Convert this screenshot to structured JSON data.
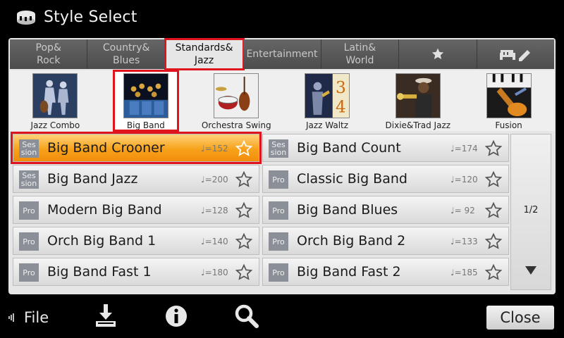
{
  "header": {
    "title": "Style Select",
    "icon": "keyboard-style-icon"
  },
  "tabs": [
    {
      "label": "Pop&\nRock",
      "active": false
    },
    {
      "label": "Country&\nBlues",
      "active": false
    },
    {
      "label": "Standards&\nJazz",
      "active": true
    },
    {
      "label": "Entertainment",
      "active": false
    },
    {
      "label": "Latin&\nWorld",
      "active": false
    },
    {
      "label": "",
      "icon": "star-icon",
      "active": false
    },
    {
      "label": "",
      "icon": "user-keyboard-edit-icon",
      "active": false
    }
  ],
  "subcategories": [
    {
      "label": "Jazz Combo",
      "active": false
    },
    {
      "label": "Big Band",
      "active": true
    },
    {
      "label": "Orchestra Swing",
      "active": false
    },
    {
      "label": "Jazz Waltz",
      "active": false,
      "thumb_text": "3\n4"
    },
    {
      "label": "Dixie&Trad Jazz",
      "active": false
    },
    {
      "label": "Fusion",
      "active": false
    }
  ],
  "styles": {
    "left": [
      {
        "badge": "Ses\nsion",
        "name": "Big Band Crooner",
        "tempo": "♩=152",
        "active": true
      },
      {
        "badge": "Ses\nsion",
        "name": "Big Band Jazz",
        "tempo": "♩=200",
        "active": false
      },
      {
        "badge": "Pro",
        "name": "Modern Big Band",
        "tempo": "♩=128",
        "active": false
      },
      {
        "badge": "Pro",
        "name": "Orch Big Band 1",
        "tempo": "♩=140",
        "active": false
      },
      {
        "badge": "Pro",
        "name": "Big Band Fast 1",
        "tempo": "♩=180",
        "active": false
      }
    ],
    "right": [
      {
        "badge": "Ses\nsion",
        "name": "Big Band Count",
        "tempo": "♩=174",
        "active": false
      },
      {
        "badge": "Pro",
        "name": "Classic Big Band",
        "tempo": "♩=120",
        "active": false
      },
      {
        "badge": "Pro",
        "name": "Big Band Blues",
        "tempo": "♩= 92",
        "active": false
      },
      {
        "badge": "Pro",
        "name": "Orch Big Band 2",
        "tempo": "♩=133",
        "active": false
      },
      {
        "badge": "Pro",
        "name": "Big Band Fast 2",
        "tempo": "♩=185",
        "active": false
      }
    ]
  },
  "scroll": {
    "page": "1/2",
    "down_icon": "triangle-down-icon"
  },
  "footer": {
    "file_label": "File",
    "icons": [
      "save-icon",
      "info-icon",
      "search-icon"
    ],
    "close_label": "Close"
  },
  "colors": {
    "highlight": "#e0141d",
    "selected_row": "#f7a21b",
    "badge": "#8b8f98"
  }
}
